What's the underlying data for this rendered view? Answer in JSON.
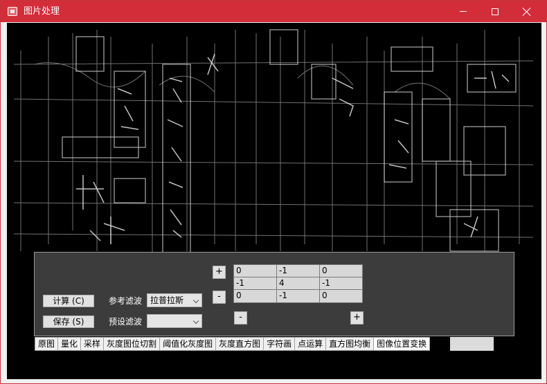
{
  "window": {
    "title": "图片处理",
    "icon": "app-image-icon",
    "controls": [
      "minimize-icon",
      "maximize-icon",
      "close-icon"
    ],
    "accent_color": "#d42d3a"
  },
  "image_view": {
    "description_color": "#000000",
    "edge_color": "#d9d9d9"
  },
  "panel": {
    "compute_button": "计算 (C)",
    "save_button": "保存 (S)",
    "ref_filter_label": "参考滤波",
    "ref_filter_value": "拉普拉斯",
    "preset_filter_label": "预设滤波",
    "preset_filter_value": "",
    "add_row_button": "+",
    "remove_row_button": "-",
    "remove_col_button": "-",
    "add_col_button": "+",
    "kernel": [
      [
        "0",
        "-1",
        "0"
      ],
      [
        "-1",
        "4",
        "-1"
      ],
      [
        "0",
        "-1",
        "0"
      ]
    ]
  },
  "tabs": [
    "原图",
    "量化",
    "采样",
    "灰度图位切割",
    "阈值化灰度图",
    "灰度直方图",
    "字符画",
    "点运算",
    "直方图均衡",
    "图像位置变换"
  ],
  "active_tab_index": 9
}
